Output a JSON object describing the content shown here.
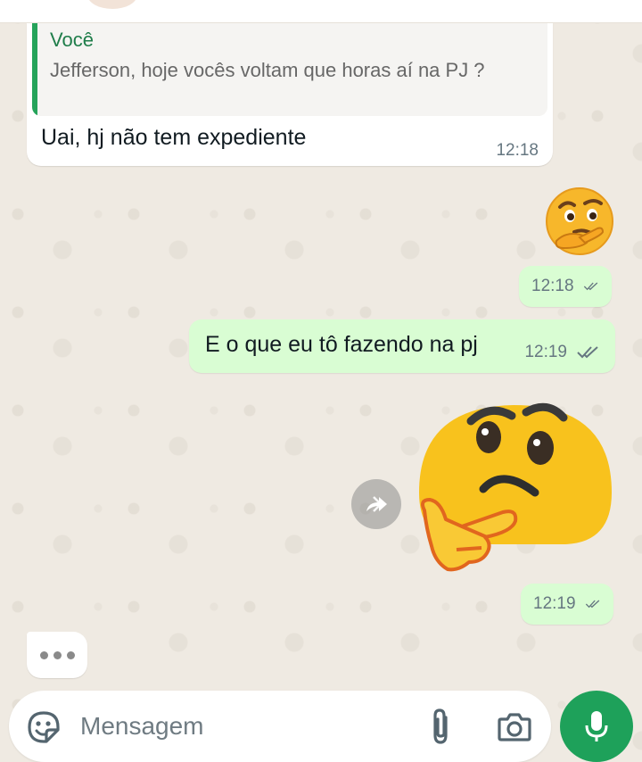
{
  "chat": {
    "incoming": {
      "quote_author": "Você",
      "quote_text": "Jefferson, hoje vocês voltam que horas aí na PJ ?",
      "text": "Uai, hj não  tem expediente",
      "time": "12:18"
    },
    "outgoing_emoji_1": {
      "emoji": "thinking-face",
      "time": "12:18",
      "status": "read"
    },
    "outgoing_text": {
      "text": "E o que eu tô fazendo na pj",
      "time": "12:19",
      "status": "read"
    },
    "outgoing_emoji_2": {
      "emoji": "thinking-face",
      "time": "12:19",
      "status": "read"
    },
    "typing_indicator": "typing-dots"
  },
  "composer": {
    "placeholder": "Mensagem",
    "value": ""
  },
  "icons": {
    "sticker": "sticker-icon",
    "attach": "paperclip-icon",
    "camera": "camera-icon",
    "mic": "microphone-icon",
    "forward": "forward-icon",
    "read_receipt": "double-check-icon"
  },
  "colors": {
    "background": "#efeae2",
    "incoming_bubble": "#ffffff",
    "outgoing_bubble": "#d9fdd3",
    "quote_bar": "#25a35a",
    "accent": "#1ea15a",
    "timestamp": "#667781"
  }
}
